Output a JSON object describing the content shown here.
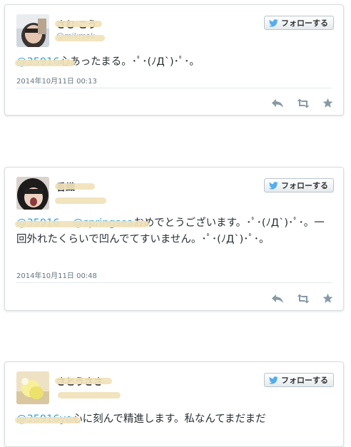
{
  "tweets": [
    {
      "author_name": "さむ こう",
      "author_handle": "@mikrsak",
      "follow_label": "フォローする",
      "mention": "@35916",
      "text": "心あったまる。･ﾟ･(ﾉД`)･ﾟ･。",
      "timestamp": "2014年10月11日  00:13",
      "actions": [
        "reply-icon",
        "retweet-icon",
        "favorite-icon"
      ]
    },
    {
      "author_name": "香織",
      "author_handle": "",
      "follow_label": "フォローする",
      "mention": "@35916    @springsea",
      "text": "おめでとうございます。･ﾟ･(ﾉД`)･ﾟ･。一回外れたくらいで凹んでてすいません。･ﾟ･(ﾉД`)･ﾟ･。",
      "timestamp": "2014年10月11日  00:48",
      "actions": [
        "reply-icon",
        "retweet-icon",
        "favorite-icon"
      ]
    },
    {
      "author_name": "さとうささ",
      "author_handle": "",
      "follow_label": "フォローする",
      "mention": "@35916yo",
      "text": "心に刻んで精進します。私なんてまだまだ",
      "timestamp": "",
      "actions": []
    }
  ],
  "colors": {
    "mention": "#2ea0d9",
    "twitter_blue": "#55acee",
    "icon_gray": "#8899a6",
    "redaction": "#f0e2b8"
  }
}
